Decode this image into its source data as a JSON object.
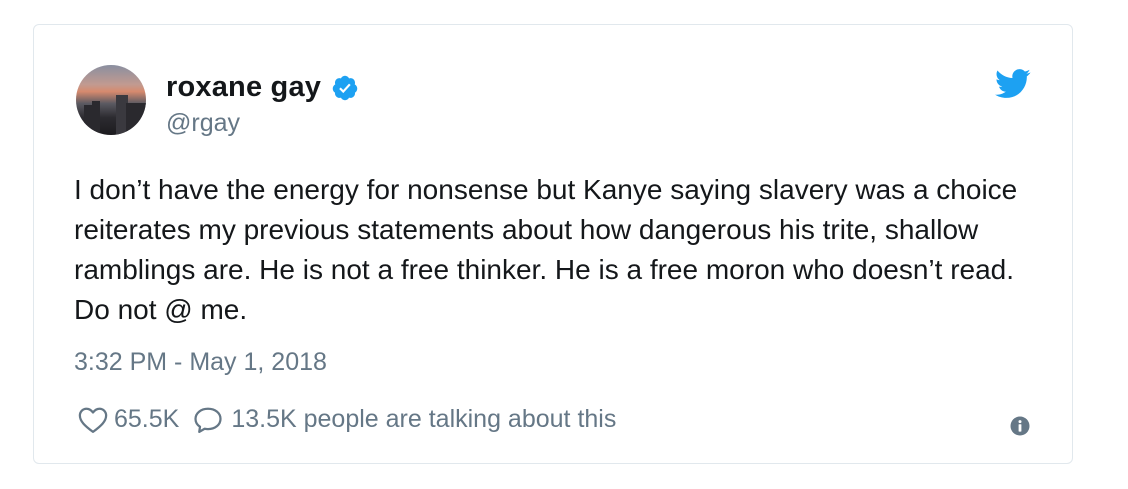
{
  "author": {
    "display_name": "roxane gay",
    "handle": "@rgay",
    "verified": true,
    "avatar_icon": "profile-photo-city-sunset"
  },
  "tweet": {
    "text": "I don’t have the energy for nonsense but Kanye saying slavery was a choice reiterates my previous statements about how dangerous his trite, shallow ramblings are. He is not a free thinker. He is a free moron who doesn’t read. Do not @ me.",
    "timestamp": "3:32 PM - May 1, 2018"
  },
  "actions": {
    "like_icon": "heart-icon",
    "like_count": "65.5K",
    "reply_icon": "speech-bubble-icon",
    "talking_text": "13.5K people are talking about this",
    "info_icon": "info-icon"
  },
  "colors": {
    "brand_blue": "#1da1f2",
    "text_primary": "#14171a",
    "text_secondary": "#657786",
    "border": "#e1e8ed"
  }
}
